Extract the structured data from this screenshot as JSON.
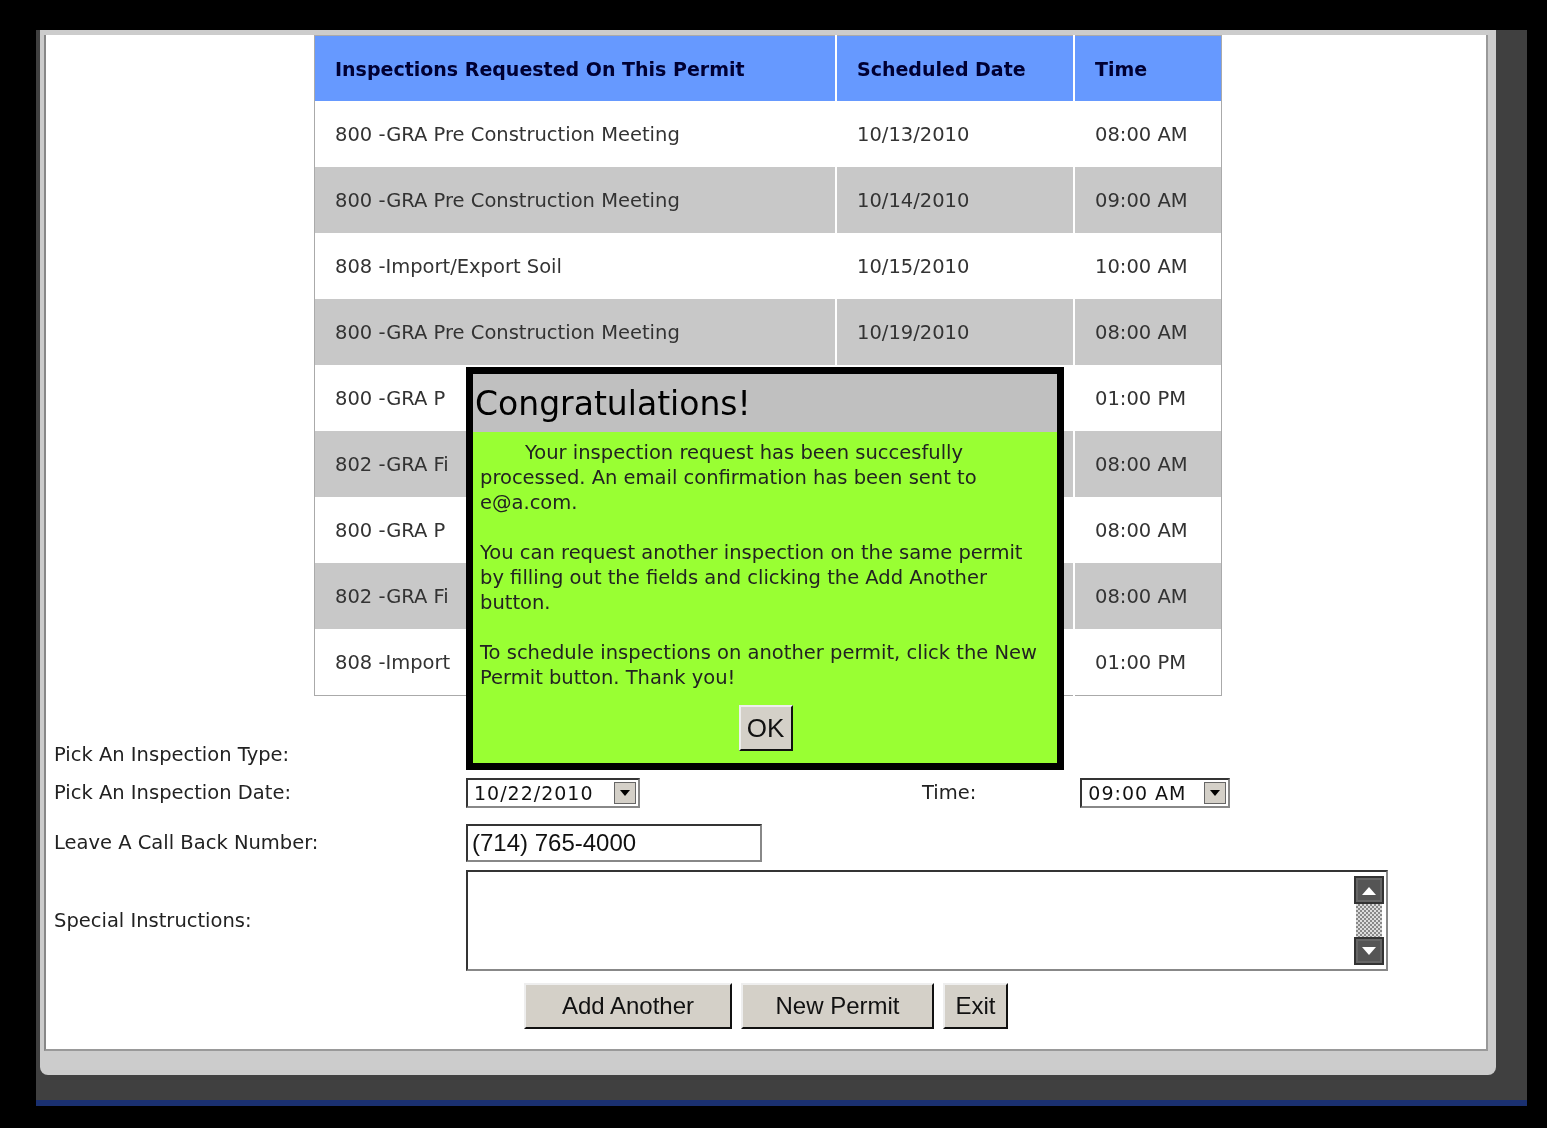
{
  "table": {
    "columns": [
      "Inspections Requested On This Permit",
      "Scheduled Date",
      "Time"
    ],
    "rows": [
      {
        "inspection": "800 -GRA Pre Construction Meeting",
        "scheduled_date": "10/13/2010",
        "time": "08:00 AM"
      },
      {
        "inspection": "800 -GRA Pre Construction Meeting",
        "scheduled_date": "10/14/2010",
        "time": "09:00 AM"
      },
      {
        "inspection": "808 -Import/Export Soil",
        "scheduled_date": "10/15/2010",
        "time": "10:00 AM"
      },
      {
        "inspection": "800 -GRA Pre Construction Meeting",
        "scheduled_date": "10/19/2010",
        "time": "08:00 AM"
      },
      {
        "inspection": "800 -GRA P",
        "time": "01:00 PM"
      },
      {
        "inspection": "802 -GRA Fi",
        "time": "08:00 AM"
      },
      {
        "inspection": "800 -GRA P",
        "time": "08:00 AM"
      },
      {
        "inspection": "802 -GRA Fi",
        "time": "08:00 AM"
      },
      {
        "inspection": "808 -Import",
        "time": "01:00 PM"
      }
    ]
  },
  "form": {
    "type_label": "Pick An Inspection Type:",
    "date_label": "Pick An Inspection Date:",
    "date_value": "10/22/2010",
    "time_label": "Time:",
    "time_value": "09:00 AM",
    "phone_label": "Leave A Call Back Number:",
    "phone_value": "(714) 765-4000",
    "instructions_label": "Special Instructions:"
  },
  "buttons": [
    "Add Another",
    "New Permit",
    "Exit"
  ],
  "dialog": {
    "title": "Congratulations!",
    "paragraphs": [
      "Your inspection request has been succesfully processed. An email confirmation has been sent to e@a.com.",
      "You can request another inspection on the same permit by filling out the fields and clicking the Add Another button.",
      "To schedule inspections on another permit, click the New Permit button. Thank you!"
    ],
    "button": "OK"
  }
}
